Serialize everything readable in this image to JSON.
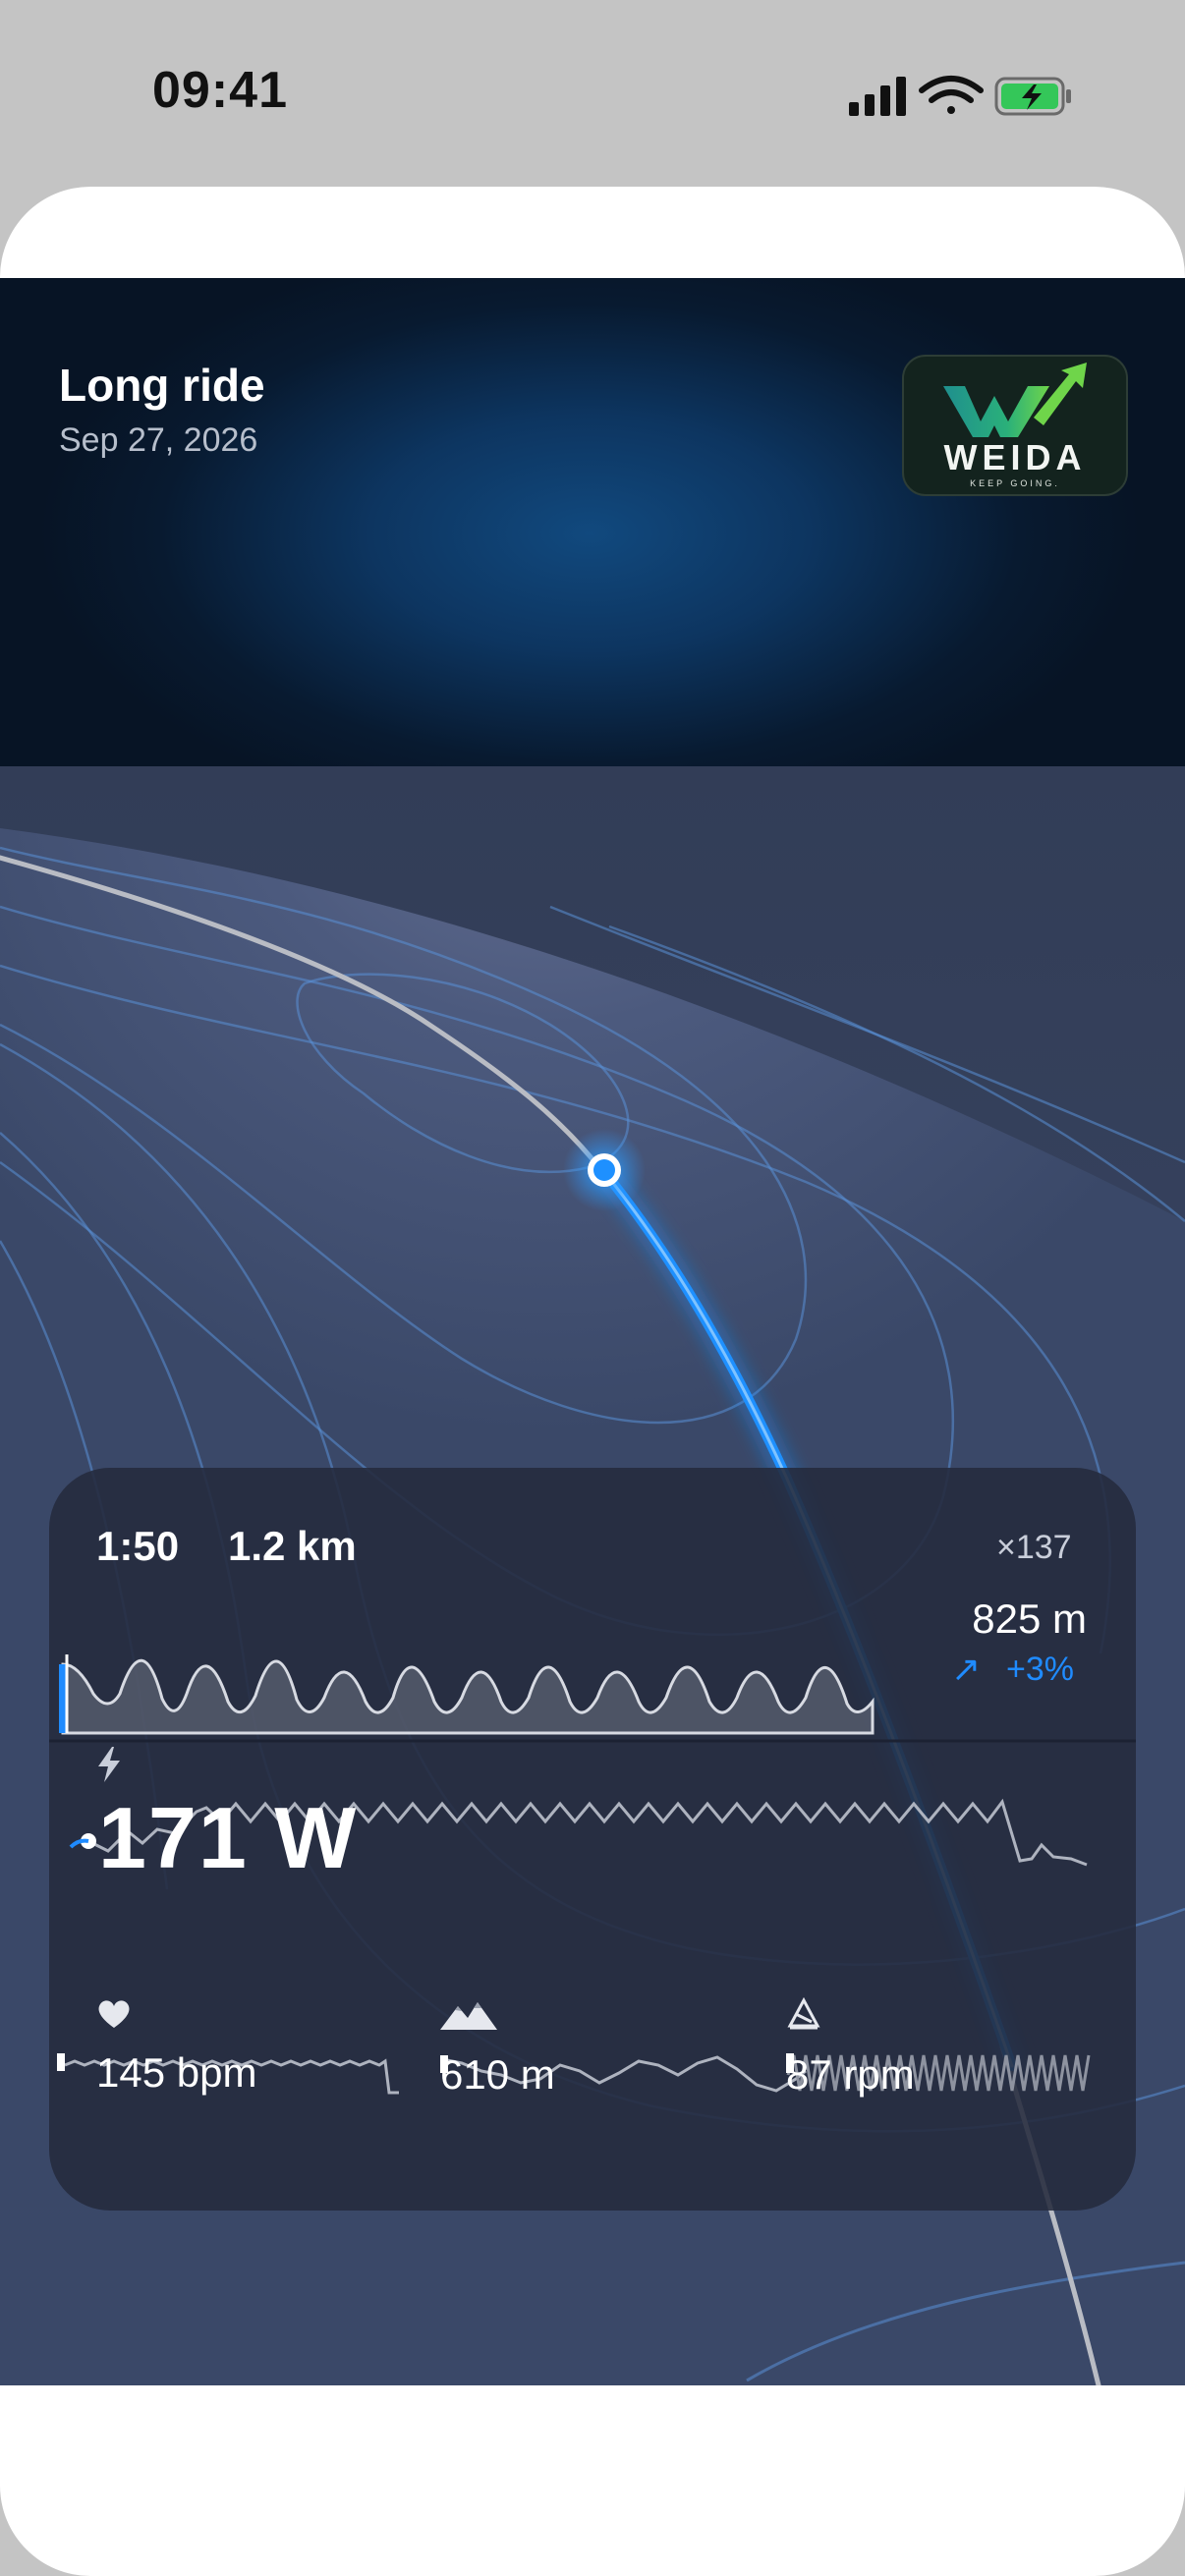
{
  "status_bar": {
    "time": "09:41",
    "icons": [
      "signal-icon",
      "wifi-icon",
      "battery-charging-icon"
    ],
    "battery_color": "#34c759"
  },
  "ride": {
    "title": "Long ride",
    "date": "Sep 27, 2026"
  },
  "logo": {
    "word": "WEIDA",
    "tagline": "KEEP GOING."
  },
  "map": {
    "route_color": "#1e90ff",
    "path_color": "#b9bcc4"
  },
  "stats": {
    "elapsed": "1:50",
    "distance": "1.2 km",
    "multiplier": "×137",
    "elevation": "825 m",
    "elevation_gain": "+3%",
    "power": "171 W",
    "metrics": [
      {
        "icon": "heart-icon",
        "value": "145 bpm"
      },
      {
        "icon": "mountain-icon",
        "value": "610 m"
      },
      {
        "icon": "cadence-icon",
        "value": "87 rpm"
      }
    ],
    "accent_color": "#1f8bff"
  }
}
